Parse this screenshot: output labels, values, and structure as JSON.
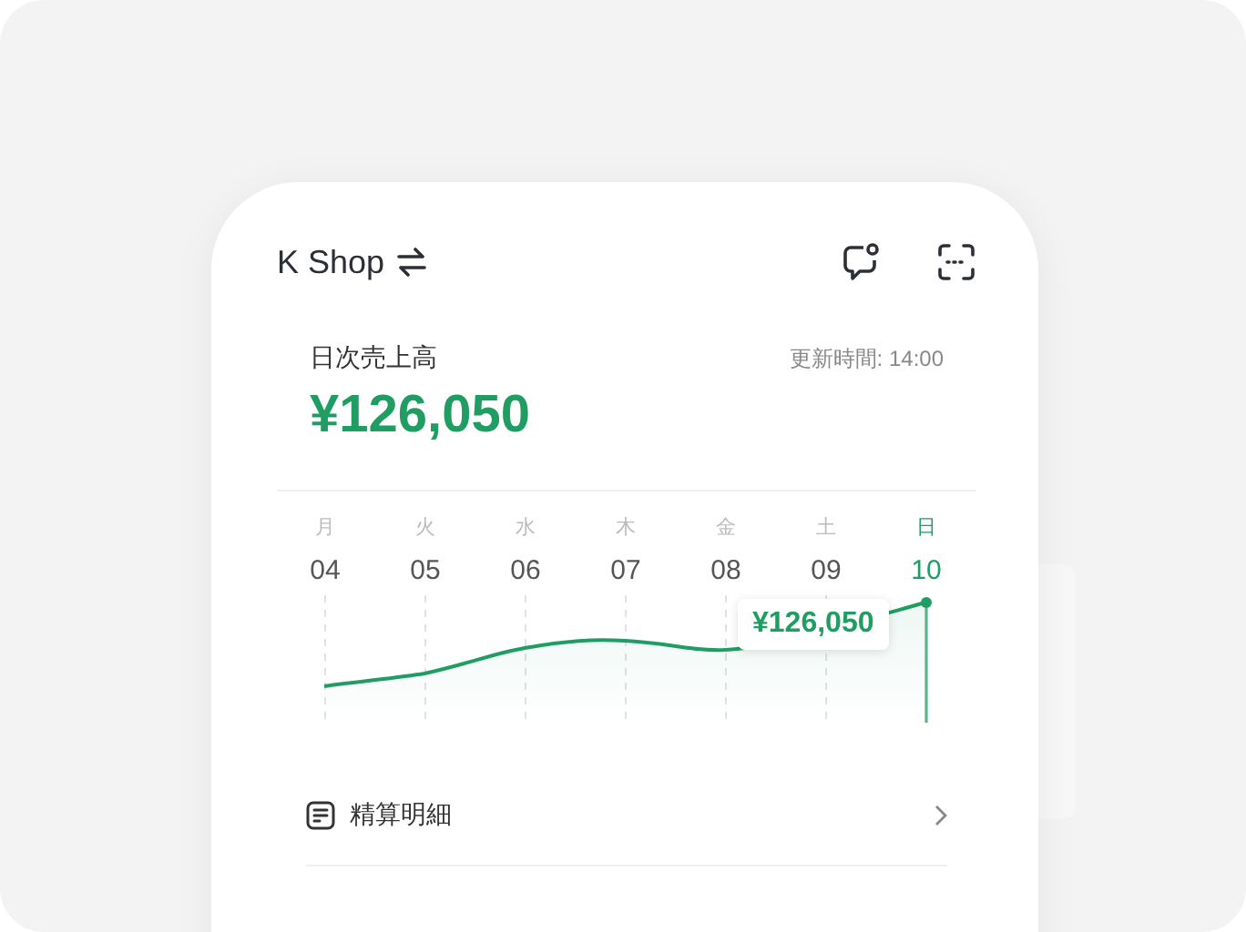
{
  "header": {
    "shop_name": "K Shop"
  },
  "summary": {
    "title": "日次売上高",
    "updated": "更新時間: 14:00",
    "amount": "¥126,050"
  },
  "days": [
    {
      "weekday": "月",
      "date": "04",
      "selected": false
    },
    {
      "weekday": "火",
      "date": "05",
      "selected": false
    },
    {
      "weekday": "水",
      "date": "06",
      "selected": false
    },
    {
      "weekday": "木",
      "date": "07",
      "selected": false
    },
    {
      "weekday": "金",
      "date": "08",
      "selected": false
    },
    {
      "weekday": "土",
      "date": "09",
      "selected": false
    },
    {
      "weekday": "日",
      "date": "10",
      "selected": true
    }
  ],
  "tooltip": {
    "amount": "¥126,050"
  },
  "menu": [
    {
      "label": "精算明細"
    }
  ]
}
